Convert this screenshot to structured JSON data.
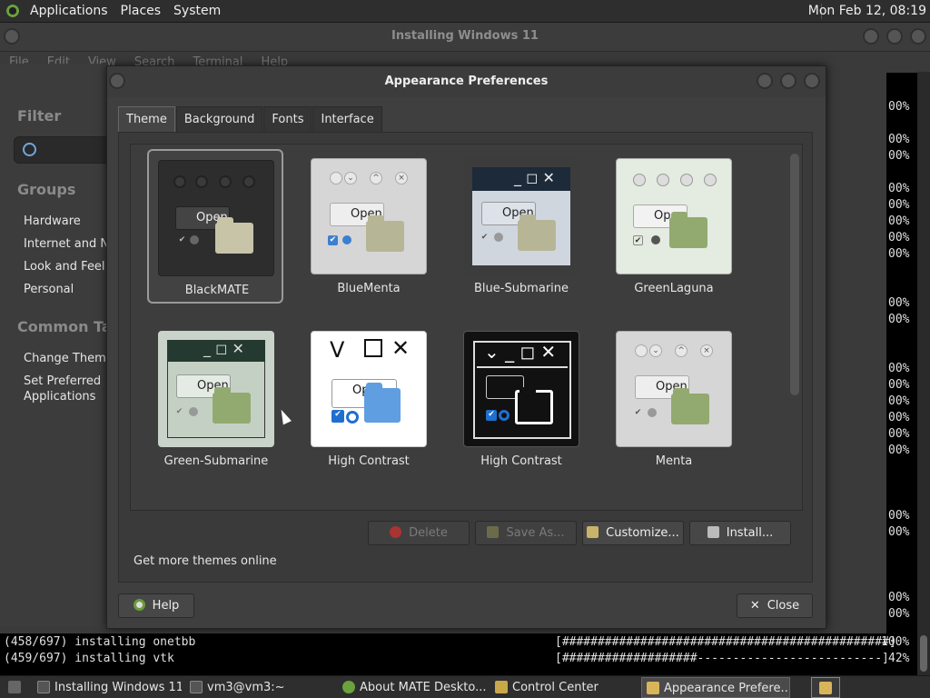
{
  "top_panel": {
    "menus": [
      "Applications",
      "Places",
      "System"
    ],
    "clock": "Mon Feb 12, 08:19"
  },
  "terminal": {
    "title": "Installing Windows 11",
    "menus": [
      "File",
      "Edit",
      "View",
      "Search",
      "Terminal",
      "Help"
    ],
    "lines": [
      {
        "left": "(458/697) installing onetbb",
        "bar": "[##############################################]",
        "pct": "100%"
      },
      {
        "left": "(459/697) installing vtk",
        "bar": "[###################--------------------------]",
        "pct": "42%"
      }
    ],
    "pct_column": [
      "00%",
      "00%",
      "00%",
      "00%",
      "00%",
      "00%",
      "00%",
      "00%",
      "00%",
      "00%",
      "00%",
      "00%",
      "00%",
      "00%",
      "00%",
      "00%",
      "00%",
      "00%",
      "00%",
      "00%"
    ]
  },
  "control_center": {
    "filter_heading": "Filter",
    "groups_heading": "Groups",
    "groups": [
      "Hardware",
      "Internet and Ne",
      "Look and Feel",
      "Personal"
    ],
    "common_heading": "Common Tasks",
    "tasks": [
      "Change Theme",
      "Set Preferred",
      "Applications"
    ]
  },
  "dialog": {
    "title": "Appearance Preferences",
    "tabs": [
      "Theme",
      "Background",
      "Fonts",
      "Interface"
    ],
    "open_label": "Open",
    "themes": [
      {
        "name": "BlackMATE"
      },
      {
        "name": "BlueMenta"
      },
      {
        "name": "Blue-Submarine"
      },
      {
        "name": "GreenLaguna"
      },
      {
        "name": "Green-Submarine"
      },
      {
        "name": "High Contrast"
      },
      {
        "name": "High Contrast"
      },
      {
        "name": "Menta"
      }
    ],
    "buttons": {
      "delete": "Delete",
      "save_as": "Save As...",
      "customize": "Customize...",
      "install": "Install..."
    },
    "more_themes": "Get more themes online",
    "help": "Help",
    "close": "Close"
  },
  "taskbar": {
    "tasks": [
      "Installing Windows 11",
      "vm3@vm3:~",
      "About MATE Deskto...",
      "Control Center",
      "Appearance Prefere..."
    ]
  }
}
